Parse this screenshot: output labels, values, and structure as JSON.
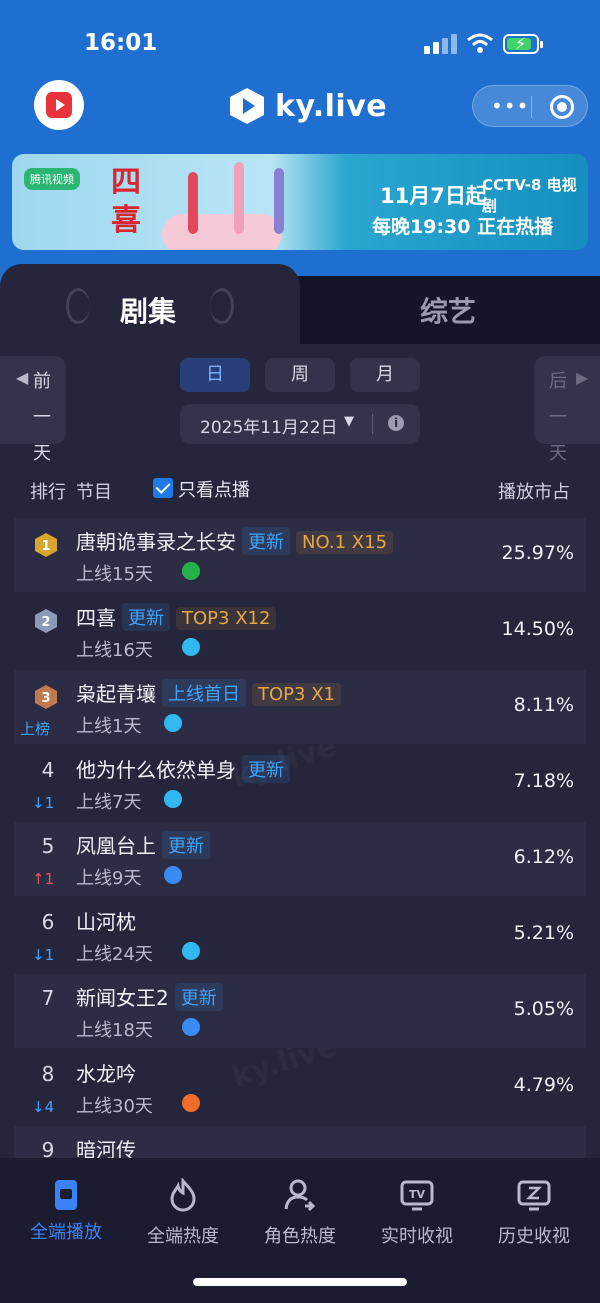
{
  "status_bar": {
    "time": "16:01"
  },
  "app": {
    "brand": "ky.live"
  },
  "banner": {
    "channel_tag": "腾讯视频",
    "drama_title": "四喜",
    "network": "CCTV-8 电视剧",
    "line1": "11月7日起",
    "line2": "每晚19:30 正在热播"
  },
  "tabs": [
    {
      "label": "剧集",
      "active": true
    },
    {
      "label": "综艺",
      "active": false
    }
  ],
  "date_nav": {
    "prev_label": "前一天",
    "next_label": "后一天",
    "periods": [
      {
        "label": "日",
        "active": true
      },
      {
        "label": "周",
        "active": false
      },
      {
        "label": "月",
        "active": false
      }
    ],
    "date": "2025年11月22日"
  },
  "table": {
    "col_rank": "排行",
    "col_show": "节目",
    "filter_label": "只看点播",
    "filter_checked": true,
    "col_share": "播放市占",
    "rows": [
      {
        "rank": "1",
        "title": "唐朝诡事录之长安",
        "tags": [
          {
            "type": "new",
            "text": "更新"
          },
          {
            "type": "top",
            "text": "NO.1 X15"
          }
        ],
        "days": "上线15天",
        "platform": "iqiyi",
        "move": "",
        "share": "25.97%"
      },
      {
        "rank": "2",
        "title": "四喜",
        "tags": [
          {
            "type": "new",
            "text": "更新"
          },
          {
            "type": "top",
            "text": "TOP3 X12"
          }
        ],
        "days": "上线16天",
        "platform": "tencent",
        "move": "",
        "share": "14.50%"
      },
      {
        "rank": "3",
        "title": "枭起青壤",
        "tags": [
          {
            "type": "new",
            "text": "上线首日"
          },
          {
            "type": "top",
            "text": "TOP3 X1"
          }
        ],
        "days": "上线1天",
        "platform": "tencent",
        "move": "上榜",
        "share": "8.11%"
      },
      {
        "rank": "4",
        "title": "他为什么依然单身",
        "tags": [
          {
            "type": "new",
            "text": "更新"
          }
        ],
        "days": "上线7天",
        "platform": "tencent",
        "move": "↓1",
        "share": "7.18%"
      },
      {
        "rank": "5",
        "title": "凤凰台上",
        "tags": [
          {
            "type": "new",
            "text": "更新"
          }
        ],
        "days": "上线9天",
        "platform": "youku",
        "move": "↑1",
        "share": "6.12%"
      },
      {
        "rank": "6",
        "title": "山河枕",
        "tags": [],
        "days": "上线24天",
        "platform": "tencent",
        "move": "↓1",
        "share": "5.21%"
      },
      {
        "rank": "7",
        "title": "新闻女王2",
        "tags": [
          {
            "type": "new",
            "text": "更新"
          }
        ],
        "days": "上线18天",
        "platform": "youku",
        "move": "",
        "share": "5.05%"
      },
      {
        "rank": "8",
        "title": "水龙吟",
        "tags": [],
        "days": "上线30天",
        "platform": "mango",
        "move": "↓4",
        "share": "4.79%"
      },
      {
        "rank": "9",
        "title": "暗河传",
        "tags": [],
        "days": "",
        "platform": "",
        "move": "",
        "share": ""
      }
    ]
  },
  "bottom_nav": [
    {
      "label": "全端播放",
      "icon": "phone-play-icon",
      "active": true
    },
    {
      "label": "全端热度",
      "icon": "flame-icon",
      "active": false
    },
    {
      "label": "角色热度",
      "icon": "person-icon",
      "active": false
    },
    {
      "label": "实时收视",
      "icon": "tv-icon",
      "active": false
    },
    {
      "label": "历史收视",
      "icon": "history-tv-icon",
      "active": false
    }
  ],
  "colors": {
    "header_blue": "#1f6fd1",
    "accent_blue": "#3b82f6",
    "tag_orange": "#e5a744",
    "background": "#25253b"
  }
}
